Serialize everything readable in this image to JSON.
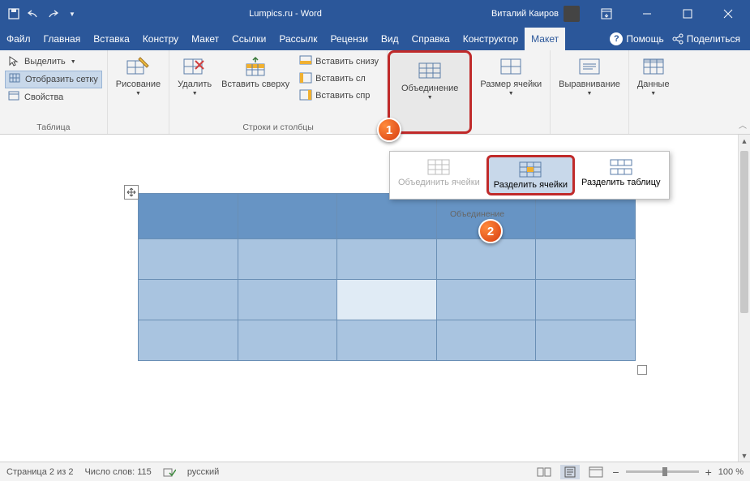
{
  "titlebar": {
    "doc_title": "Lumpics.ru  -  Word",
    "user_name": "Виталий Каиров"
  },
  "tabs": {
    "file": "Файл",
    "home": "Главная",
    "insert": "Вставка",
    "design": "Констру",
    "layout": "Макет",
    "references": "Ссылки",
    "mailings": "Рассылк",
    "review": "Рецензи",
    "view": "Вид",
    "help": "Справка",
    "table_design": "Конструктор",
    "table_layout": "Макет",
    "tell_me": "Помощь",
    "share": "Поделиться"
  },
  "ribbon": {
    "table_group": "Таблица",
    "select": "Выделить",
    "show_grid": "Отобразить сетку",
    "properties": "Свойства",
    "draw_group": "Рисование",
    "draw": "Рисование",
    "delete": "Удалить",
    "insert_above": "Вставить сверху",
    "insert_below": "Вставить снизу",
    "insert_left": "Вставить сл",
    "insert_right": "Вставить спр",
    "rows_cols_group": "Строки и столбцы",
    "merge": "Объединение",
    "cell_size": "Размер ячейки",
    "alignment": "Выравнивание",
    "data": "Данные"
  },
  "dropdown": {
    "merge_cells": "Объединить ячейки",
    "split_cells": "Разделить ячейки",
    "split_table": "Разделить таблицу",
    "group_label": "Объединение"
  },
  "status": {
    "page": "Страница 2 из 2",
    "words": "Число слов: 115",
    "lang": "русский",
    "zoom": "100 %"
  }
}
